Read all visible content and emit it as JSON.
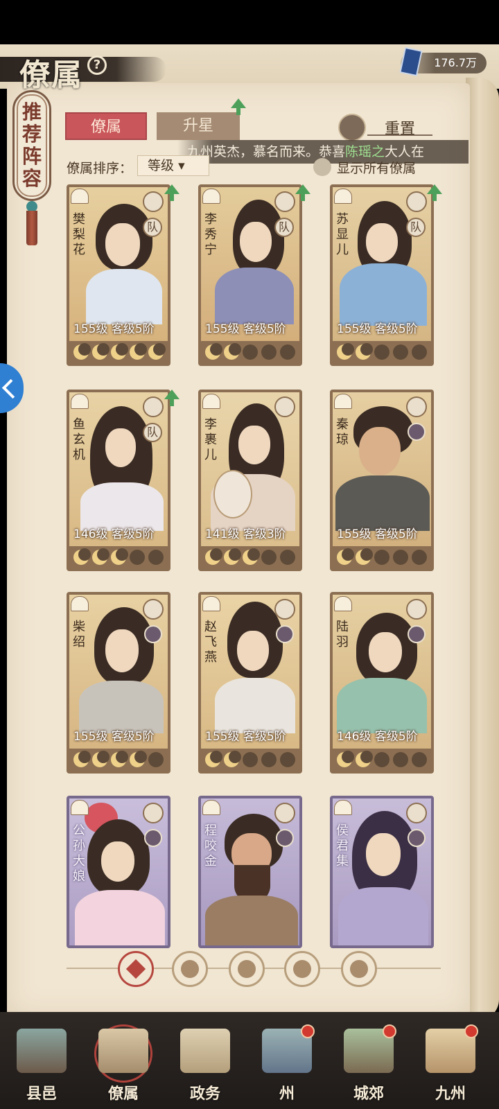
{
  "header": {
    "title": "僚属",
    "help_icon": "question-mark-icon",
    "currency_value": "176.7万",
    "currency_icon": "book-icon"
  },
  "recommend": {
    "label": "推荐阵容"
  },
  "tabs": [
    {
      "label": "僚属",
      "active": true
    },
    {
      "label": "升星",
      "active": false
    }
  ],
  "reset": {
    "label": "重置",
    "icon": "reset-icon"
  },
  "marquee": {
    "text_before": "九州英杰，慕名而来。恭喜",
    "highlight_name": "陈瑶之",
    "text_after": "大人在"
  },
  "sort": {
    "label": "僚属排序：",
    "selected": "等级"
  },
  "show_all": {
    "label": "显示所有僚属",
    "checked": false
  },
  "cards": [
    {
      "name": "樊梨花",
      "level": "155级",
      "rank": "客级5阶",
      "stars_lit": 5
    },
    {
      "name": "李秀宁",
      "level": "155级",
      "rank": "客级5阶",
      "stars_lit": 2
    },
    {
      "name": "苏显儿",
      "level": "155级",
      "rank": "客级5阶",
      "stars_lit": 2
    },
    {
      "name": "鱼玄机",
      "level": "146级",
      "rank": "客级5阶",
      "stars_lit": 3
    },
    {
      "name": "李裹儿",
      "level": "141级",
      "rank": "客级3阶",
      "stars_lit": 3
    },
    {
      "name": "秦琼",
      "level": "155级",
      "rank": "客级5阶",
      "stars_lit": 2
    },
    {
      "name": "柴绍",
      "level": "155级",
      "rank": "客级5阶",
      "stars_lit": 4
    },
    {
      "name": "赵飞燕",
      "level": "155级",
      "rank": "客级5阶",
      "stars_lit": 2
    },
    {
      "name": "陆羽",
      "level": "146级",
      "rank": "客级5阶",
      "stars_lit": 2
    },
    {
      "name": "公孙大娘"
    },
    {
      "name": "程咬金"
    },
    {
      "name": "侯君集"
    }
  ],
  "badges": {
    "team": "队"
  },
  "filters": [
    {
      "icon": "all-diamond-icon",
      "active": true
    },
    {
      "icon": "bell-icon",
      "active": false
    },
    {
      "icon": "gourd-icon",
      "active": false
    },
    {
      "icon": "fan-icon",
      "active": false
    },
    {
      "icon": "lion-icon",
      "active": false
    }
  ],
  "nav": [
    {
      "label": "县邑",
      "dot": false,
      "active": false
    },
    {
      "label": "僚属",
      "dot": false,
      "active": true
    },
    {
      "label": "政务",
      "dot": false,
      "active": false
    },
    {
      "label": "州",
      "dot": true,
      "active": false
    },
    {
      "label": "城郊",
      "dot": true,
      "active": false
    },
    {
      "label": "九州",
      "dot": true,
      "active": false
    }
  ],
  "colors": {
    "accent_red": "#c9565a",
    "paper": "#f1e6d2",
    "card_border": "#8c6f52",
    "card_purple": "#77698c",
    "highlight_green": "#9fe091"
  }
}
